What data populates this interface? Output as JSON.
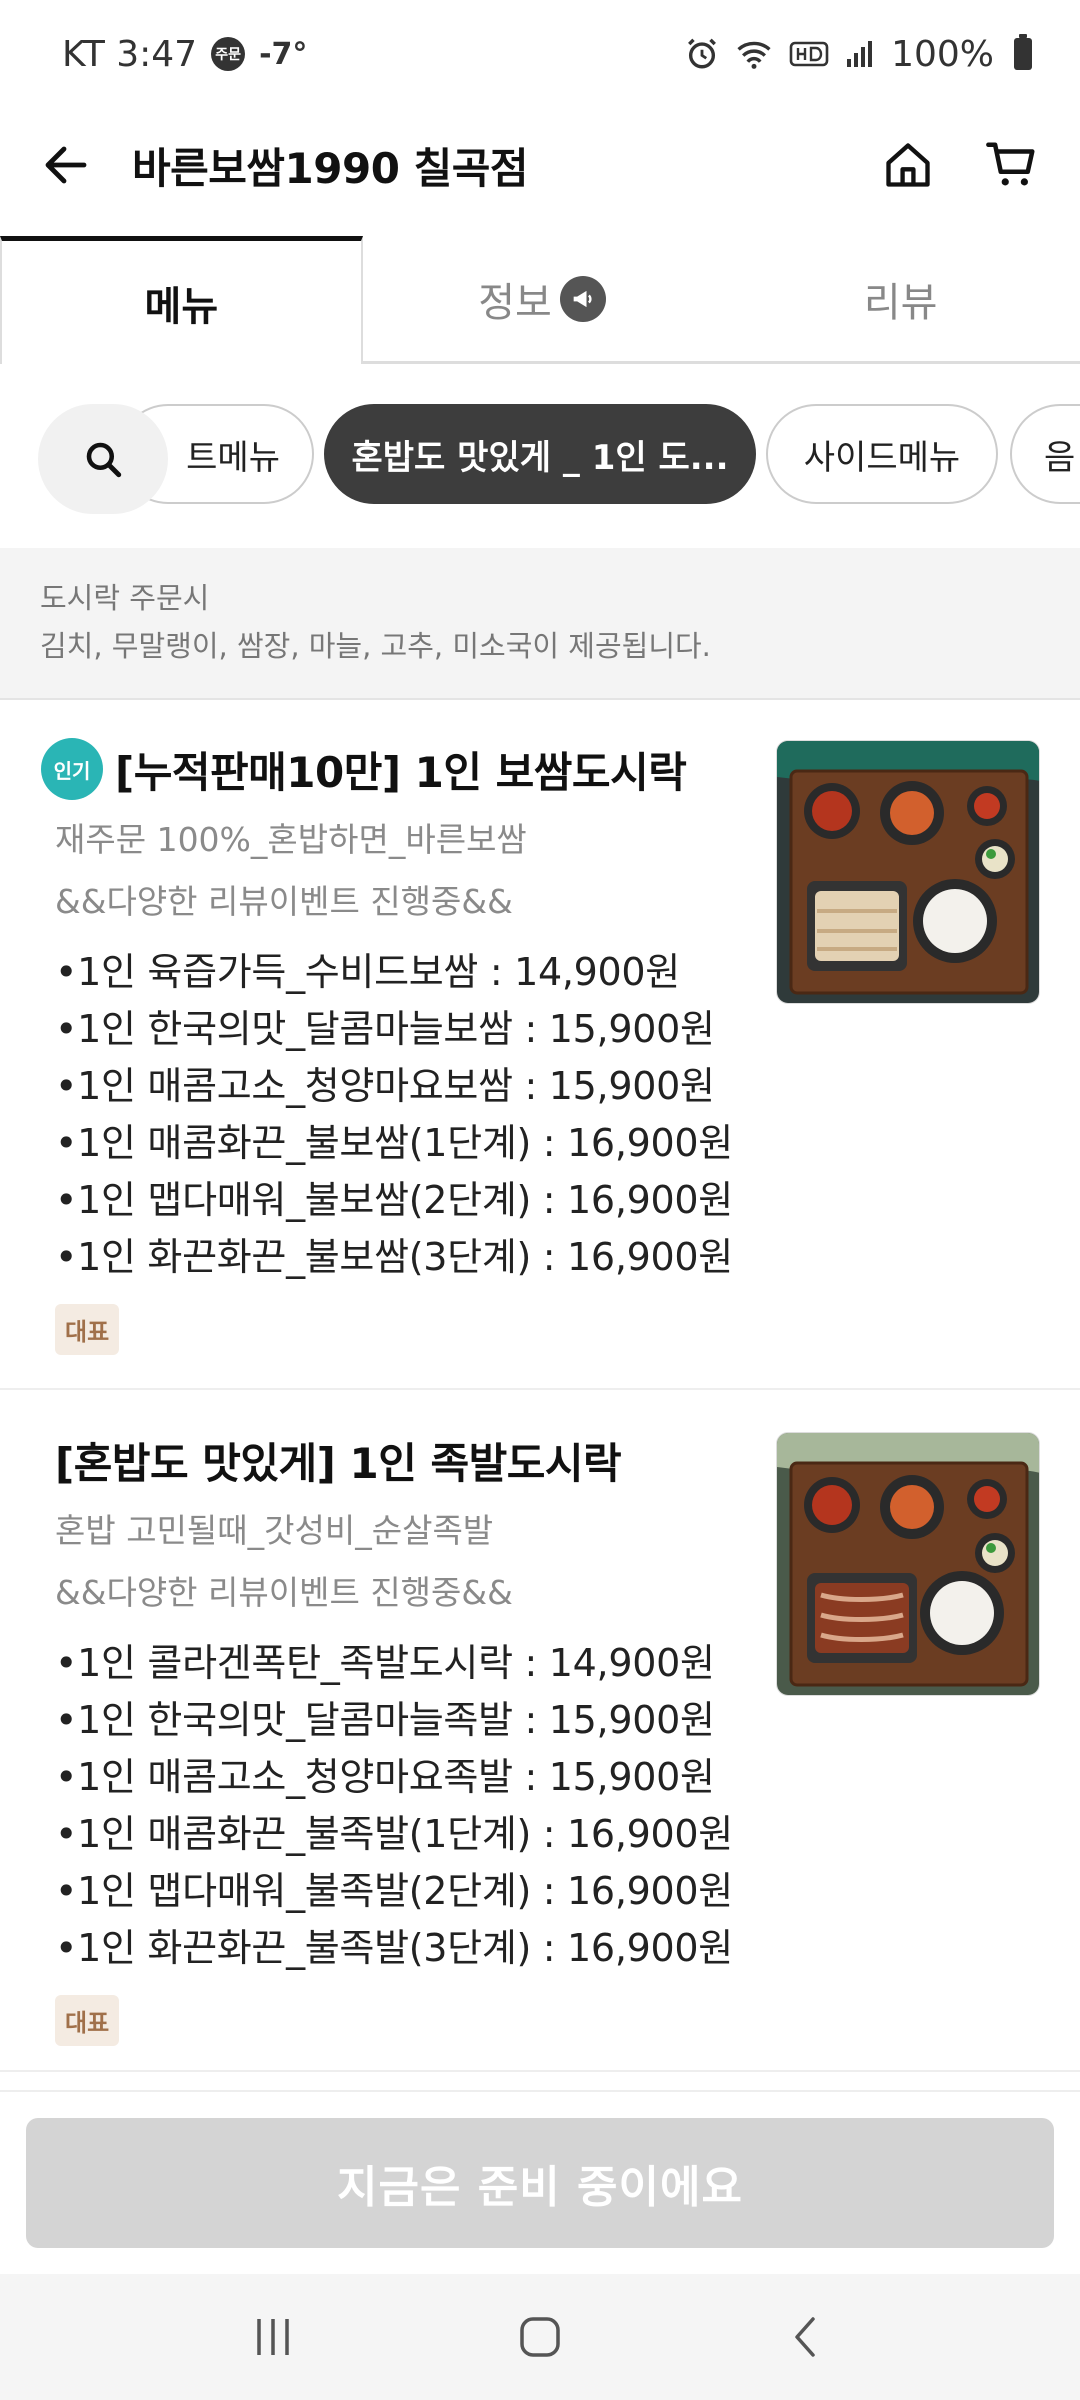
{
  "status_bar": {
    "carrier_time": "KT 3:47",
    "badge": "주문",
    "temperature": "-7°",
    "battery": "100%"
  },
  "header": {
    "title": "바른보쌈1990 칠곡점"
  },
  "tabs": [
    {
      "label": "메뉴",
      "active": true
    },
    {
      "label": "정보",
      "active": false
    },
    {
      "label": "리뷰",
      "active": false
    }
  ],
  "categories": [
    {
      "label": "트메뉴",
      "active": false
    },
    {
      "label": "혼밥도 맛있게 _ 1인 도...",
      "active": true
    },
    {
      "label": "사이드메뉴",
      "active": false
    },
    {
      "label": "음",
      "active": false
    }
  ],
  "notice": {
    "line1": "도시락 주문시",
    "line2": "김치, 무말랭이, 쌈장, 마늘, 고추, 미소국이 제공됩니다."
  },
  "menu_items": [
    {
      "badge": "인기",
      "title": "[누적판매10만] 1인 보쌈도시락",
      "desc": "재주문 100%_혼밥하면_바른보쌈",
      "desc2": "&&다양한 리뷰이벤트 진행중&&",
      "options": [
        "•1인 육즙가득_수비드보쌈 : 14,900원",
        "•1인 한국의맛_달콤마늘보쌈 : 15,900원",
        "•1인 매콤고소_청양마요보쌈 : 15,900원",
        "•1인 매콤화끈_불보쌈(1단계) : 16,900원",
        "•1인 맵다매워_불보쌈(2단계) : 16,900원",
        "•1인 화끈화끈_불보쌈(3단계) : 16,900원"
      ],
      "tag": "대표"
    },
    {
      "title": "[혼밥도 맛있게] 1인 족발도시락",
      "desc": "혼밥 고민될때_갓성비_순살족발",
      "desc2": "&&다양한 리뷰이벤트 진행중&&",
      "options": [
        "•1인 콜라겐폭탄_족발도시락 : 14,900원",
        "•1인 한국의맛_달콤마늘족발 : 15,900원",
        "•1인 매콤고소_청양마요족발 : 15,900원",
        "•1인 매콤화끈_불족발(1단계) : 16,900원",
        "•1인 맵다매워_불족발(2단계) : 16,900원",
        "•1인 화끈화끈_불족발(3단계) : 16,900원"
      ],
      "tag": "대표"
    }
  ],
  "bottom_button": {
    "label": "지금은 준비 중이에요"
  },
  "colors": {
    "popular_badge": "#2ab5b5",
    "active_chip": "#3d3d3d",
    "disabled_button": "#d4d4d4",
    "tag_bg": "#f4ebe2",
    "tag_text": "#a0704a"
  },
  "icons": [
    "back-arrow-icon",
    "home-icon",
    "cart-icon",
    "megaphone-icon",
    "search-icon",
    "recents-icon",
    "home-nav-icon",
    "back-nav-icon"
  ]
}
